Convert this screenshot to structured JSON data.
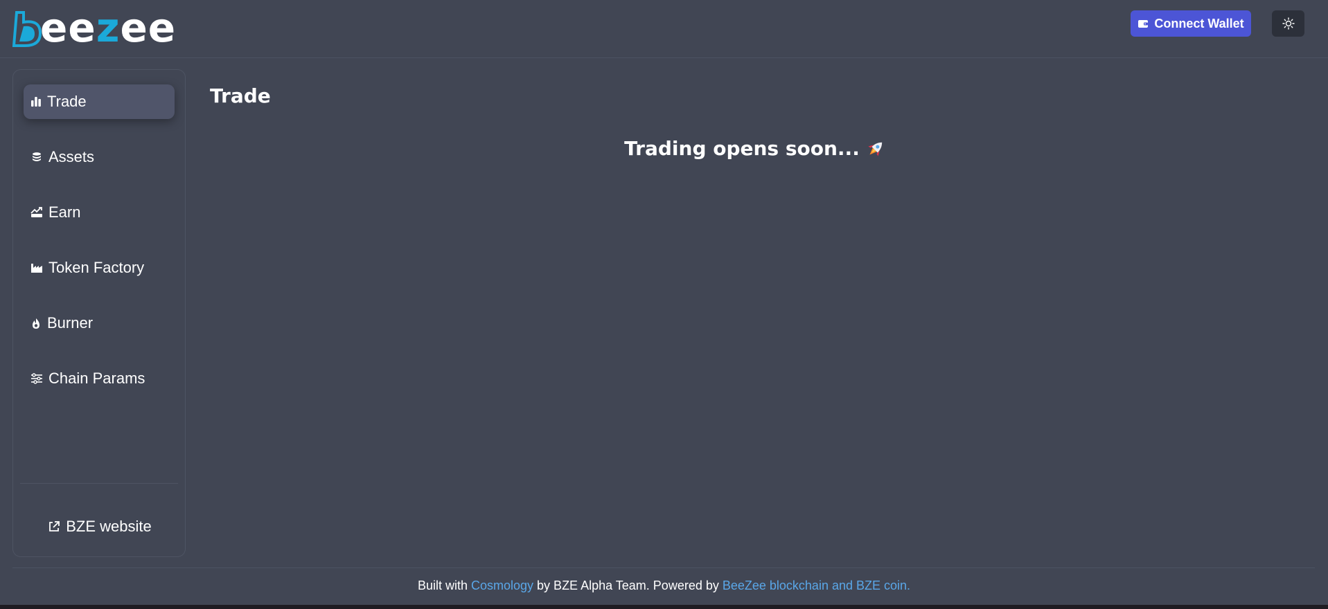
{
  "header": {
    "logo_text_b": "b",
    "logo_text_ee": "ee",
    "logo_text_z": "z",
    "logo_text_ee2": "ee",
    "connect_wallet_label": "Connect Wallet",
    "theme_icon": "sun-icon",
    "wallet_icon": "wallet-icon"
  },
  "sidebar": {
    "items": [
      {
        "label": "Trade",
        "icon": "bar-chart-icon",
        "active": true
      },
      {
        "label": "Assets",
        "icon": "coins-icon",
        "active": false
      },
      {
        "label": "Earn",
        "icon": "growth-icon",
        "active": false
      },
      {
        "label": "Token Factory",
        "icon": "factory-icon",
        "active": false
      },
      {
        "label": "Burner",
        "icon": "flame-icon",
        "active": false
      },
      {
        "label": "Chain Params",
        "icon": "sliders-icon",
        "active": false
      }
    ],
    "external_link": {
      "label": "BZE website",
      "icon": "external-link-icon"
    }
  },
  "main": {
    "title": "Trade",
    "notice": "Trading opens soon...",
    "notice_icon": "rocket-icon"
  },
  "footer": {
    "text1": "Built with ",
    "link1": "Cosmology",
    "text2": " by BZE Alpha Team. Powered by ",
    "link2": "BeeZee blockchain and BZE coin."
  },
  "colors": {
    "background": "#414654",
    "accent_button": "#4c55d6",
    "logo_accent": "#1ba9d9",
    "link": "#5aa7e8"
  }
}
